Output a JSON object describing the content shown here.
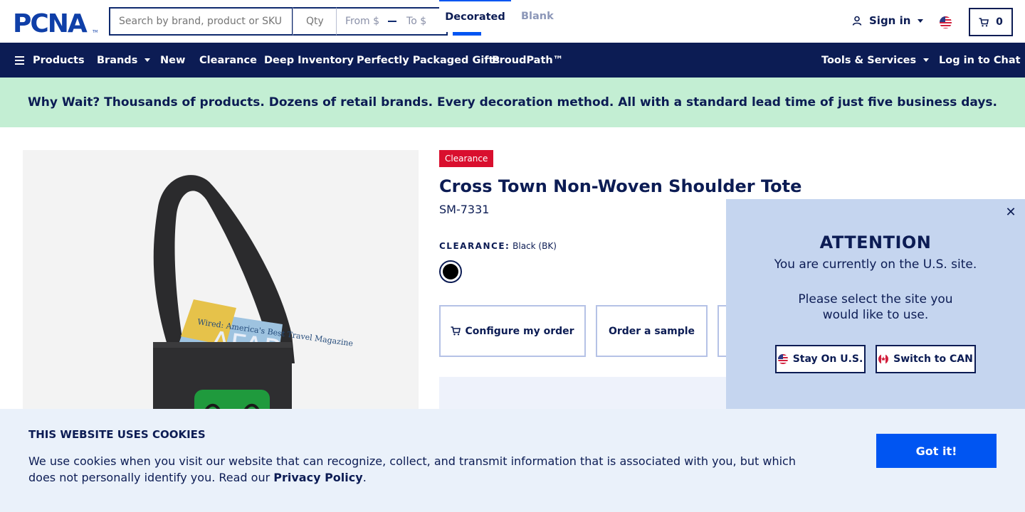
{
  "header": {
    "logo_text": "PCNA",
    "search_placeholder": "Search by brand, product or SKU",
    "qty_placeholder": "Qty",
    "price_from": "From $",
    "price_to": "To $",
    "signin_label": "Sign in",
    "cart_count": "0"
  },
  "nav": {
    "products": "Products",
    "brands": "Brands",
    "new": "New",
    "clearance": "Clearance",
    "deep_inventory": "Deep Inventory",
    "packaged_gifts": "Perfectly Packaged Gifts",
    "proudpath": "ProudPath™",
    "tools": "Tools & Services",
    "chat": "Log in to Chat"
  },
  "promo": {
    "text": "Why Wait? Thousands of products. Dozens of retail brands. Every decoration method. All with a standard lead time of just five business days."
  },
  "product": {
    "badge": "Clearance",
    "title": "Cross Town Non-Woven Shoulder Tote",
    "sku": "SM-7331",
    "color_key": "CLEARANCE:",
    "color_value": "Black (BK)",
    "configure_label": "Configure my order",
    "sample_label": "Order a sample",
    "tab_decorated": "Decorated",
    "tab_blank": "Blank"
  },
  "attention": {
    "title": "ATTENTION",
    "line1": "You are currently on the U.S. site.",
    "line2": "Please select the site you",
    "line3": "would like to use.",
    "stay_label": "Stay On U.S.",
    "switch_label": "Switch to CAN"
  },
  "cookies": {
    "title": "THIS WEBSITE USES COOKIES",
    "text": "We use cookies when you visit our website that can recognize, collect, and transmit information that is associated with you, but which does not personally identify you. Read our ",
    "link": "Privacy Policy",
    "end": ".",
    "button": "Got it!"
  },
  "colors": {
    "navy": "#0c1c54",
    "accent_blue": "#0055f2",
    "promo_green": "#c3eed3",
    "clearance_red": "#d90f2e",
    "popup_blue": "#c5d5ef"
  }
}
